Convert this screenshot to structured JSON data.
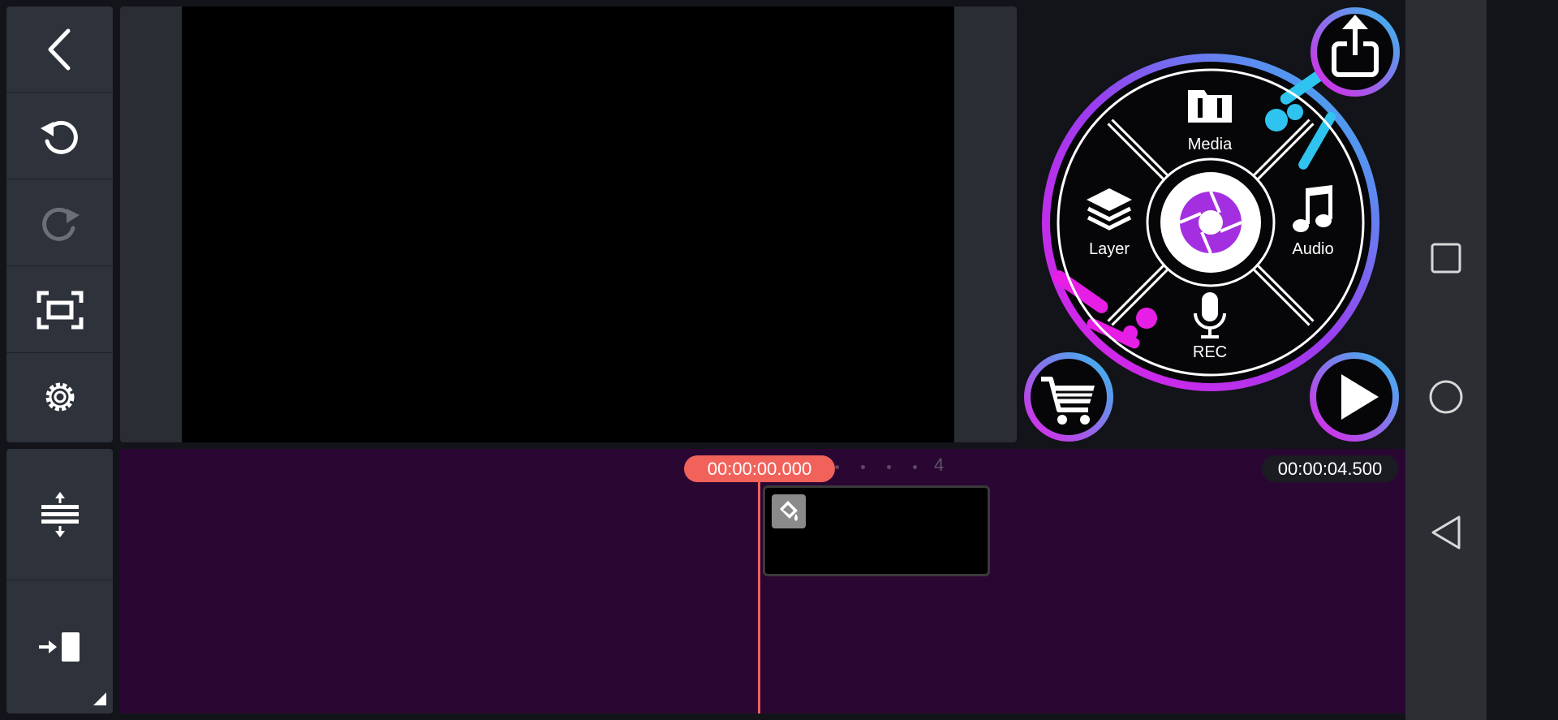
{
  "toolbar": {
    "back": "back-icon",
    "undo": "undo-icon",
    "redo": "redo-icon",
    "fit": "fit-screen-icon",
    "settings": "gear-icon",
    "adjust": "track-height-icon",
    "jump_end": "jump-to-end-icon"
  },
  "hub": {
    "media_label": "Media",
    "layer_label": "Layer",
    "audio_label": "Audio",
    "rec_label": "REC"
  },
  "timeline": {
    "current_time": "00:00:00.000",
    "total_time": "00:00:04.500",
    "ruler_mark": "4"
  },
  "colors": {
    "accent": "#f0625a",
    "timeline_bg": "#2a0733",
    "toolbar_bg": "#2e323b",
    "hub_cyan": "#2fc3ef",
    "hub_magenta": "#e61ee6",
    "hub_purple": "#9b3df0"
  }
}
